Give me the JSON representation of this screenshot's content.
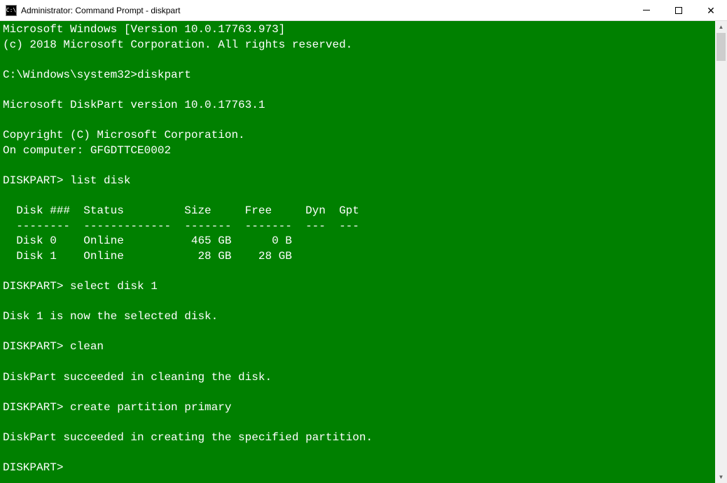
{
  "titlebar": {
    "icon_text": "C:\\",
    "title": "Administrator: Command Prompt - diskpart"
  },
  "terminal": {
    "lines": [
      "Microsoft Windows [Version 10.0.17763.973]",
      "(c) 2018 Microsoft Corporation. All rights reserved.",
      "",
      "C:\\Windows\\system32>diskpart",
      "",
      "Microsoft DiskPart version 10.0.17763.1",
      "",
      "Copyright (C) Microsoft Corporation.",
      "On computer: GFGDTTCE0002",
      "",
      "DISKPART> list disk",
      "",
      "  Disk ###  Status         Size     Free     Dyn  Gpt",
      "  --------  -------------  -------  -------  ---  ---",
      "  Disk 0    Online          465 GB      0 B",
      "  Disk 1    Online           28 GB    28 GB",
      "",
      "DISKPART> select disk 1",
      "",
      "Disk 1 is now the selected disk.",
      "",
      "DISKPART> clean",
      "",
      "DiskPart succeeded in cleaning the disk.",
      "",
      "DISKPART> create partition primary",
      "",
      "DiskPart succeeded in creating the specified partition.",
      "",
      "DISKPART>"
    ]
  }
}
